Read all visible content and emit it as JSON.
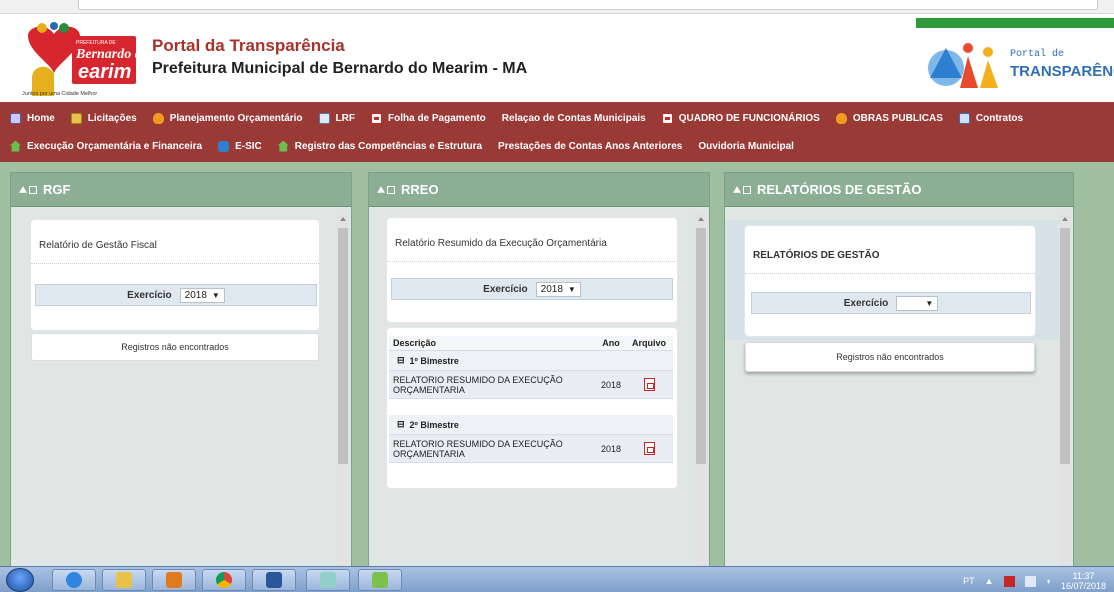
{
  "header": {
    "logo_left": {
      "line1": "PREFEITURA DE",
      "line2": "Bernardo do",
      "line3": "earim",
      "slogan": "Juntos por uma Cidade Melhor"
    },
    "portal_title": "Portal da Transparência",
    "pref_title": "Prefeitura Municipal de Bernardo do Mearim - MA",
    "logo_right": {
      "line1": "Portal de",
      "line2": "TRANSPARÊNCIA"
    }
  },
  "nav": {
    "row1": [
      {
        "label": "Home",
        "icon": "home-icon"
      },
      {
        "label": "Licitações",
        "icon": "folder-icon"
      },
      {
        "label": "Planejamento Orçamentário",
        "icon": "flame-icon"
      },
      {
        "label": "LRF",
        "icon": "document-icon"
      },
      {
        "label": "Folha de Pagamento",
        "icon": "pdf-icon"
      },
      {
        "label": "Relaçao de Contas Municipais",
        "icon": ""
      },
      {
        "label": "QUADRO DE FUNCIONÁRIOS",
        "icon": "pdf-icon"
      },
      {
        "label": "OBRAS PUBLICAS",
        "icon": "flame-icon"
      },
      {
        "label": "Contratos",
        "icon": "table-icon"
      }
    ],
    "row2": [
      {
        "label": "Execução Orçamentária e Financeira",
        "icon": "house-icon"
      },
      {
        "label": "E-SIC",
        "icon": "info-icon"
      },
      {
        "label": "Registro das Competências e Estrutura",
        "icon": "house-icon"
      },
      {
        "label": "Prestações de Contas Anos Anteriores",
        "icon": ""
      },
      {
        "label": "Ouvidoria Municipal",
        "icon": ""
      }
    ]
  },
  "panels": {
    "rgf": {
      "title": "RGF",
      "card_title": "Relatório de Gestão Fiscal",
      "exercicio_label": "Exercício",
      "exercicio_value": "2018",
      "no_records": "Registros não encontrados"
    },
    "rreo": {
      "title": "RREO",
      "card_title": "Relatório Resumido da Execução Orçamentária",
      "exercicio_label": "Exercício",
      "exercicio_value": "2018",
      "table": {
        "headers": {
          "descricao": "Descrição",
          "ano": "Ano",
          "arquivo": "Arquivo"
        },
        "groups": [
          {
            "label": "1º Bimestre",
            "rows": [
              {
                "descricao": "RELATORIO RESUMIDO DA EXECUÇÃO ORÇAMENTARIA",
                "ano": "2018"
              }
            ]
          },
          {
            "label": "2º Bimestre",
            "rows": [
              {
                "descricao": "RELATORIO RESUMIDO DA EXECUÇÃO ORÇAMENTARIA",
                "ano": "2018"
              }
            ]
          }
        ]
      }
    },
    "gestao": {
      "title": "RELATÓRIOS DE GESTÃO",
      "card_title": "RELATÓRIOS DE GESTÃO",
      "exercicio_label": "Exercício",
      "exercicio_value": "",
      "no_records": "Registros não encontrados"
    }
  },
  "taskbar": {
    "lang": "PT",
    "time": "11:37",
    "date": "16/07/2018"
  },
  "colors": {
    "nav_bg": "#9a3a37",
    "panel_head": "#8cae94",
    "portal_title": "#a8332b",
    "page_bg": "#9fbfa0"
  }
}
